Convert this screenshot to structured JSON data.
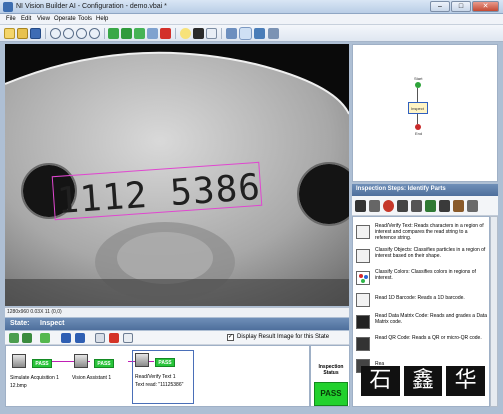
{
  "window": {
    "title": "NI Vision Builder AI - Configuration - demo.vbai *",
    "controls": {
      "minimize": "–",
      "maximize": "□",
      "close": "✕"
    }
  },
  "menubar": {
    "items": [
      "File",
      "Edit",
      "View",
      "Operate",
      "Tools",
      "Help"
    ]
  },
  "image": {
    "ocr_text": "1112 5386",
    "status": "1280x960 0.03X 11    (0,0)"
  },
  "state": {
    "label": "State:",
    "value": "Inspect",
    "display_result_checkbox": "Display Result Image for this State",
    "display_result_checked": true
  },
  "steps": [
    {
      "name": "Simulate Acquisition 1",
      "detail": "12.bmp",
      "status": "PASS"
    },
    {
      "name": "Vision Assistant 1",
      "detail": "",
      "status": "PASS"
    },
    {
      "name": "Read/Verify Text 1",
      "detail": "Text read: \"11125386\"",
      "status": "PASS"
    }
  ],
  "inspection_status": {
    "heading_line1": "Inspection",
    "heading_line2": "Status",
    "result": "PASS"
  },
  "flow": {
    "start": "Start",
    "inspect": "Inspect",
    "end": "End"
  },
  "inspection_steps": {
    "header": "Inspection Steps: Identify Parts",
    "items": [
      {
        "icon": "read-verify-text-icon",
        "text": "Read/Verify Text: Reads characters in a region of interest and compares the read string to a reference string."
      },
      {
        "icon": "classify-objects-icon",
        "text": "Classify Objects: Classifies particles in a region of interest based on their shape."
      },
      {
        "icon": "classify-colors-icon",
        "text": "Classify Colors: Classifies colors in regions of interest."
      },
      {
        "icon": "barcode-icon",
        "text": "Read 1D Barcode: Reads a 1D barcode."
      },
      {
        "icon": "data-matrix-icon",
        "text": "Read Data Matrix Code: Reads and grades a Data Matrix code."
      },
      {
        "icon": "qr-code-icon",
        "text": "Read QR Code: Reads a QR or micro-QR code."
      },
      {
        "icon": "pdf417-icon",
        "text": "Rea"
      }
    ]
  },
  "watermark": {
    "chars": [
      "石",
      "鑫",
      "华"
    ]
  },
  "colors": {
    "pass_green": "#29c43a",
    "roi_magenta": "#e046d0",
    "header_blue": "#5a7ba8"
  }
}
